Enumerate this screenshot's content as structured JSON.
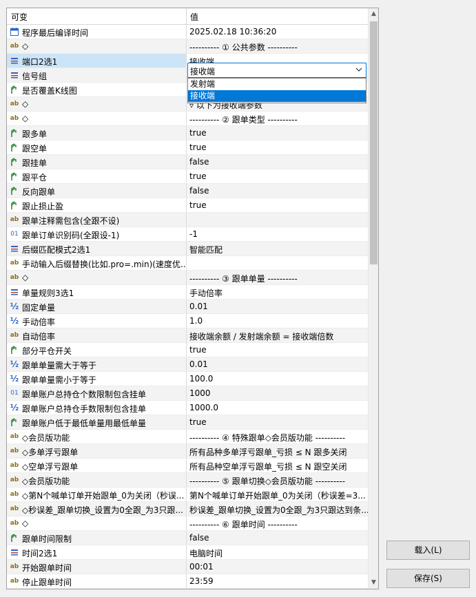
{
  "header": {
    "col1": "可变",
    "col2": "值"
  },
  "rows": [
    {
      "icon": "calendar-icon",
      "name": "程序最后编译时间",
      "value": "2025.02.18 10:36:20"
    },
    {
      "icon": "ab-icon",
      "name": "◇",
      "value": "---------- ① 公共参数 ----------"
    },
    {
      "icon": "enum-icon",
      "name": "端口2选1",
      "value": "接收端",
      "selected": true
    },
    {
      "icon": "enum-icon",
      "name": "信号组",
      "value": ""
    },
    {
      "icon": "bool-icon",
      "name": "是否覆盖K线图",
      "value": ""
    },
    {
      "icon": "ab-icon",
      "name": "◇",
      "value": "▿ 以下为接收端参数"
    },
    {
      "icon": "ab-icon",
      "name": "◇",
      "value": "---------- ② 跟单类型 ----------"
    },
    {
      "icon": "bool-icon",
      "name": "跟多单",
      "value": "true"
    },
    {
      "icon": "bool-icon",
      "name": "跟空单",
      "value": "true"
    },
    {
      "icon": "bool-icon",
      "name": "跟挂单",
      "value": "false"
    },
    {
      "icon": "bool-icon",
      "name": "跟平仓",
      "value": "true"
    },
    {
      "icon": "bool-icon",
      "name": "反向跟单",
      "value": "false"
    },
    {
      "icon": "bool-icon",
      "name": "跟止损止盈",
      "value": "true"
    },
    {
      "icon": "ab-icon",
      "name": "跟单注释需包含(全跟不设)",
      "value": ""
    },
    {
      "icon": "num-icon",
      "name": "跟单订单识别码(全跟设-1)",
      "value": "-1"
    },
    {
      "icon": "enum-icon",
      "name": "后缀匹配模式2选1",
      "value": "智能匹配"
    },
    {
      "icon": "ab-icon",
      "name": "手动输入后缀替换(比如.pro=.min)(速度优...",
      "value": ""
    },
    {
      "icon": "ab-icon",
      "name": "◇",
      "value": "---------- ③ 跟单单量 ----------"
    },
    {
      "icon": "enum-icon",
      "name": "单量规则3选1",
      "value": "手动倍率"
    },
    {
      "icon": "half-icon",
      "name": "固定单量",
      "value": "0.01"
    },
    {
      "icon": "half-icon",
      "name": "手动倍率",
      "value": "1.0"
    },
    {
      "icon": "ab-icon",
      "name": "自动倍率",
      "value": "接收端余额 / 发射端余额 = 接收端倍数"
    },
    {
      "icon": "bool-icon",
      "name": "部分平仓开关",
      "value": "true"
    },
    {
      "icon": "half-icon",
      "name": "跟单单量需大于等于",
      "value": "0.01"
    },
    {
      "icon": "half-icon",
      "name": "跟单单量需小于等于",
      "value": "100.0"
    },
    {
      "icon": "num-icon",
      "name": "跟单账户总持仓个数限制包含挂单",
      "value": "1000"
    },
    {
      "icon": "half-icon",
      "name": "跟单账户总持仓手数限制包含挂单",
      "value": "1000.0"
    },
    {
      "icon": "bool-icon",
      "name": "跟单账户低于最低单量用最低单量",
      "value": "true"
    },
    {
      "icon": "ab-icon",
      "name": "◇会员版功能",
      "value": "---------- ④ 特殊跟单◇会员版功能 ----------"
    },
    {
      "icon": "ab-icon",
      "name": "◇多单浮亏跟单",
      "value": "所有品种多单浮亏跟单_亏损 ≤ N 跟多关闭"
    },
    {
      "icon": "ab-icon",
      "name": "◇空单浮亏跟单",
      "value": "所有品种空单浮亏跟单_亏损 ≤ N 跟空关闭"
    },
    {
      "icon": "ab-icon",
      "name": "◇会员版功能",
      "value": "---------- ⑤ 跟单切换◇会员版功能 ----------"
    },
    {
      "icon": "ab-icon",
      "name": "◇第N个喊单订单开始跟单_0为关闭（秒误...",
      "value": "第N个喊单订单开始跟单_0为关闭（秒误差=3..."
    },
    {
      "icon": "ab-icon",
      "name": "◇秒误差_跟单切换_设置为0全跟_为3只跟...",
      "value": "秒误差_跟单切换_设置为0全跟_为3只跟达到条..."
    },
    {
      "icon": "ab-icon",
      "name": "◇",
      "value": "---------- ⑥ 跟单时间 ----------"
    },
    {
      "icon": "bool-icon",
      "name": "跟单时间限制",
      "value": "false"
    },
    {
      "icon": "enum-icon",
      "name": "时间2选1",
      "value": "电脑时间"
    },
    {
      "icon": "ab-icon",
      "name": "开始跟单时间",
      "value": "00:01"
    },
    {
      "icon": "ab-icon",
      "name": "停止跟单时间",
      "value": "23:59"
    }
  ],
  "dropdown": {
    "current": "接收端",
    "options": [
      "发射端",
      "接收端"
    ],
    "highlighted": 1
  },
  "buttons": {
    "load": "载入(L)",
    "save": "保存(S)"
  }
}
